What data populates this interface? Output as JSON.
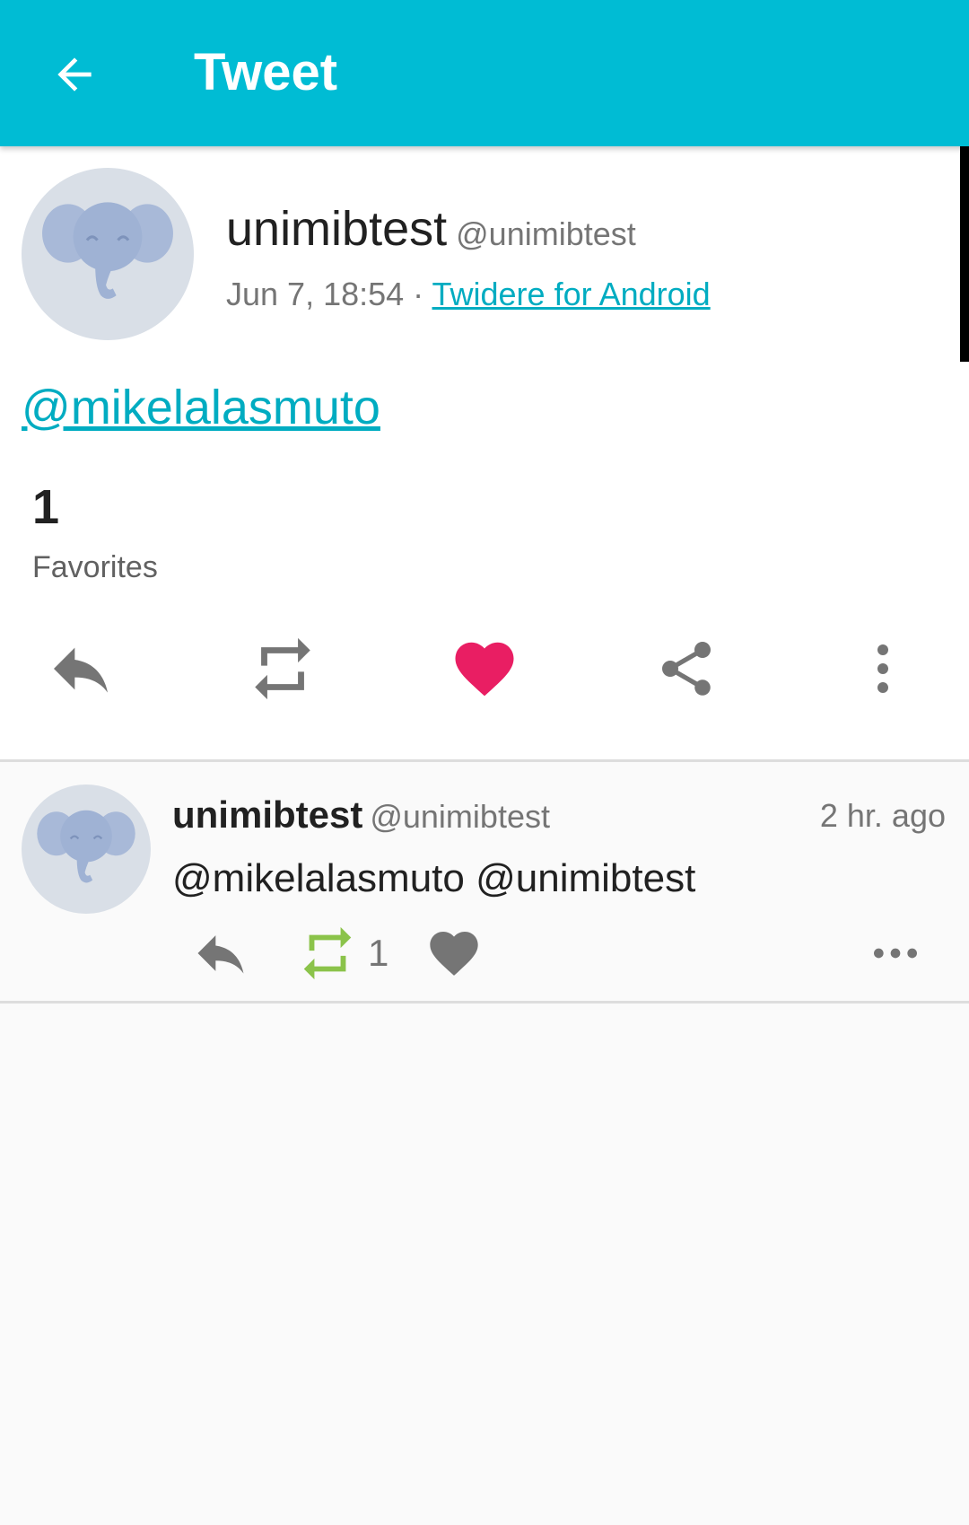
{
  "toolbar": {
    "title": "Tweet",
    "back_icon": "arrow-back-icon",
    "background_color": "#00bcd4"
  },
  "status": {
    "avatar_icon": "elephant-avatar-icon",
    "name": "unimibtest",
    "handle": "@unimibtest",
    "time": "Jun 7, 18:54",
    "separator": " · ",
    "source": "Twidere for Android",
    "text": "@mikelalasmuto",
    "favorites_count": "1",
    "favorites_label": "Favorites",
    "actions": [
      {
        "name": "reply",
        "icon": "reply-icon"
      },
      {
        "name": "retweet",
        "icon": "retweet-icon"
      },
      {
        "name": "favorite",
        "icon": "heart-icon",
        "active": true,
        "color": "#e91e63"
      },
      {
        "name": "share",
        "icon": "share-icon"
      },
      {
        "name": "more",
        "icon": "more-vertical-icon"
      }
    ]
  },
  "replies": [
    {
      "avatar_icon": "elephant-avatar-icon",
      "name": "unimibtest",
      "handle": "@unimibtest",
      "time": "2 hr. ago",
      "text": "@mikelalasmuto @unimibtest",
      "retweet_count": "1",
      "retweet_color": "#8bc34a",
      "actions": [
        {
          "name": "reply",
          "icon": "reply-icon"
        },
        {
          "name": "retweet",
          "icon": "retweet-icon",
          "active": true
        },
        {
          "name": "favorite",
          "icon": "heart-icon"
        },
        {
          "name": "more",
          "icon": "more-horizontal-icon"
        }
      ]
    }
  ]
}
